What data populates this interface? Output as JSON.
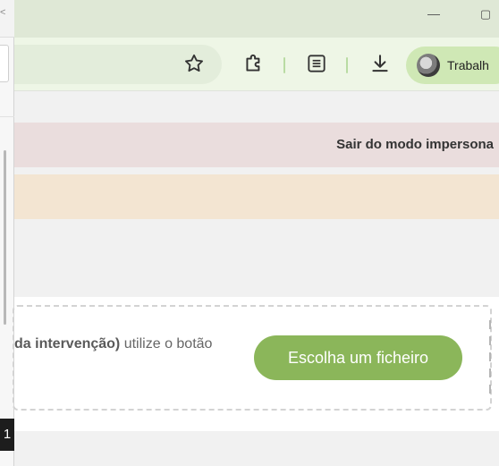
{
  "browser": {
    "profile_label": "Trabalh",
    "window_minimize": "—",
    "window_restore": "▢"
  },
  "side_panel": {
    "close_glyph": "<",
    "badge": "1"
  },
  "page": {
    "banner_text": "Sair do modo impersona",
    "upload": {
      "instruction_bold": "da intervenção)",
      "instruction_rest": " utilize o botão",
      "button_label": "Escolha um ficheiro"
    }
  },
  "colors": {
    "accent_button": "#8bb65a",
    "banner_red": "#eadddd",
    "banner_orange": "#f3e5d2",
    "titlebar": "#dfe8d6",
    "toolbar": "#eef6e6"
  }
}
